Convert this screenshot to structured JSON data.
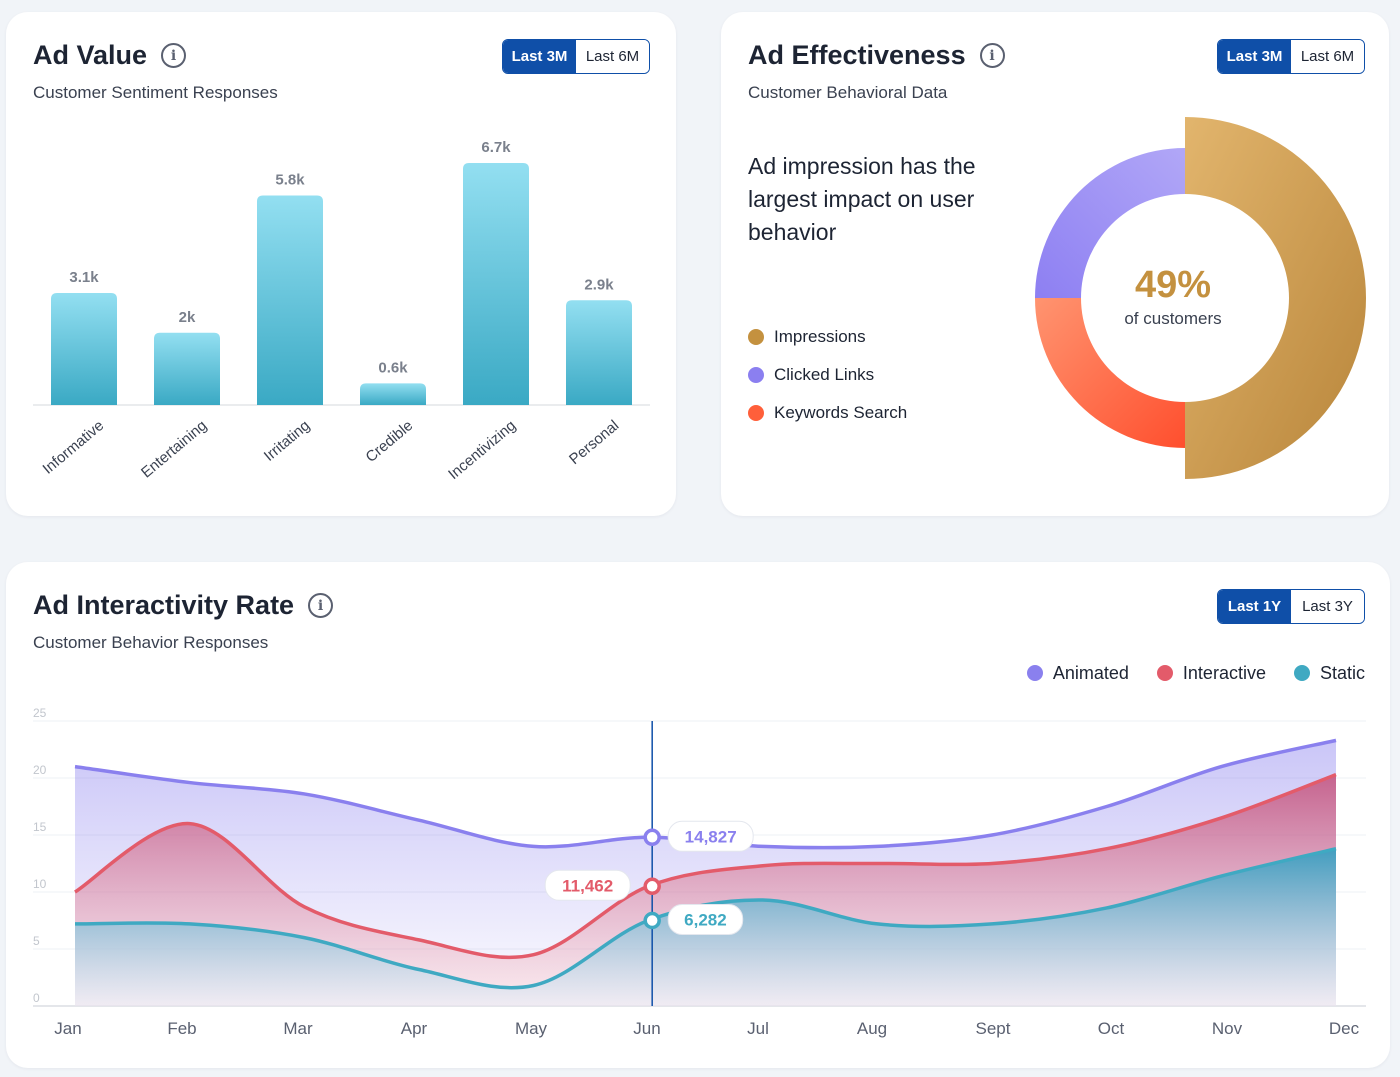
{
  "ad_value": {
    "title": "Ad Value",
    "subtitle": "Customer Sentiment Responses",
    "toggle": [
      "Last 3M",
      "Last 6M"
    ]
  },
  "ad_effectiveness": {
    "title": "Ad Effectiveness",
    "subtitle": "Customer Behavioral Data",
    "toggle": [
      "Last 3M",
      "Last 6M"
    ],
    "headline": "Ad impression has the largest impact on user behavior",
    "center_value": "49%",
    "center_label": "of customers"
  },
  "ad_interactivity": {
    "title": "Ad Interactivity Rate",
    "subtitle": "Customer Behavior Responses",
    "toggle": [
      "Last 1Y",
      "Last 3Y"
    ]
  },
  "colors": {
    "accent": "#0f4fa8",
    "impressions": "#c4913f",
    "clicked_links": "#8b7ff0",
    "keywords_search": "#ff5f3a",
    "animated": "#8a80ee",
    "interactive": "#e35b6a",
    "static": "#3fa9c2"
  },
  "chart_data": [
    {
      "type": "bar",
      "categories": [
        "Informative",
        "Entertaining",
        "Irritating",
        "Credible",
        "Incentivizing",
        "Personal"
      ],
      "values": [
        3.1,
        2.0,
        5.8,
        0.6,
        6.7,
        2.9
      ],
      "data_labels": [
        "3.1k",
        "2k",
        "5.8k",
        "0.6k",
        "6.7k",
        "2.9k"
      ],
      "ylim": [
        0,
        7.2
      ]
    },
    {
      "type": "pie",
      "donut": true,
      "labels": [
        "Impressions",
        "Clicked Links",
        "Keywords Search"
      ],
      "values": [
        50,
        25,
        25
      ],
      "center_text": "49%",
      "center_subtext": "of customers",
      "legend_position": "left"
    },
    {
      "type": "area",
      "categories": [
        "Jan",
        "Feb",
        "Mar",
        "Apr",
        "May",
        "Jun",
        "Jul",
        "Aug",
        "Sept",
        "Oct",
        "Nov",
        "Dec"
      ],
      "yticks": [
        0,
        5,
        10,
        15,
        20,
        25
      ],
      "ylim": [
        0,
        25
      ],
      "series": [
        {
          "name": "Animated",
          "values": [
            21,
            19.6,
            18.6,
            16.3,
            14,
            14.8,
            14,
            14,
            15,
            17.5,
            21,
            23.3
          ]
        },
        {
          "name": "Interactive",
          "values": [
            10,
            16,
            8.7,
            5.8,
            4.5,
            10.5,
            12.3,
            12.5,
            12.5,
            13.8,
            16.5,
            20.3
          ]
        },
        {
          "name": "Static",
          "values": [
            7.2,
            7.2,
            6,
            3.2,
            1.8,
            7.5,
            9.3,
            7.2,
            7.2,
            8.6,
            11.4,
            13.8
          ]
        }
      ],
      "highlight": {
        "category": "Jun",
        "labels": [
          "14,827",
          "11,462",
          "6,282"
        ]
      },
      "legend_position": "top-right"
    }
  ]
}
